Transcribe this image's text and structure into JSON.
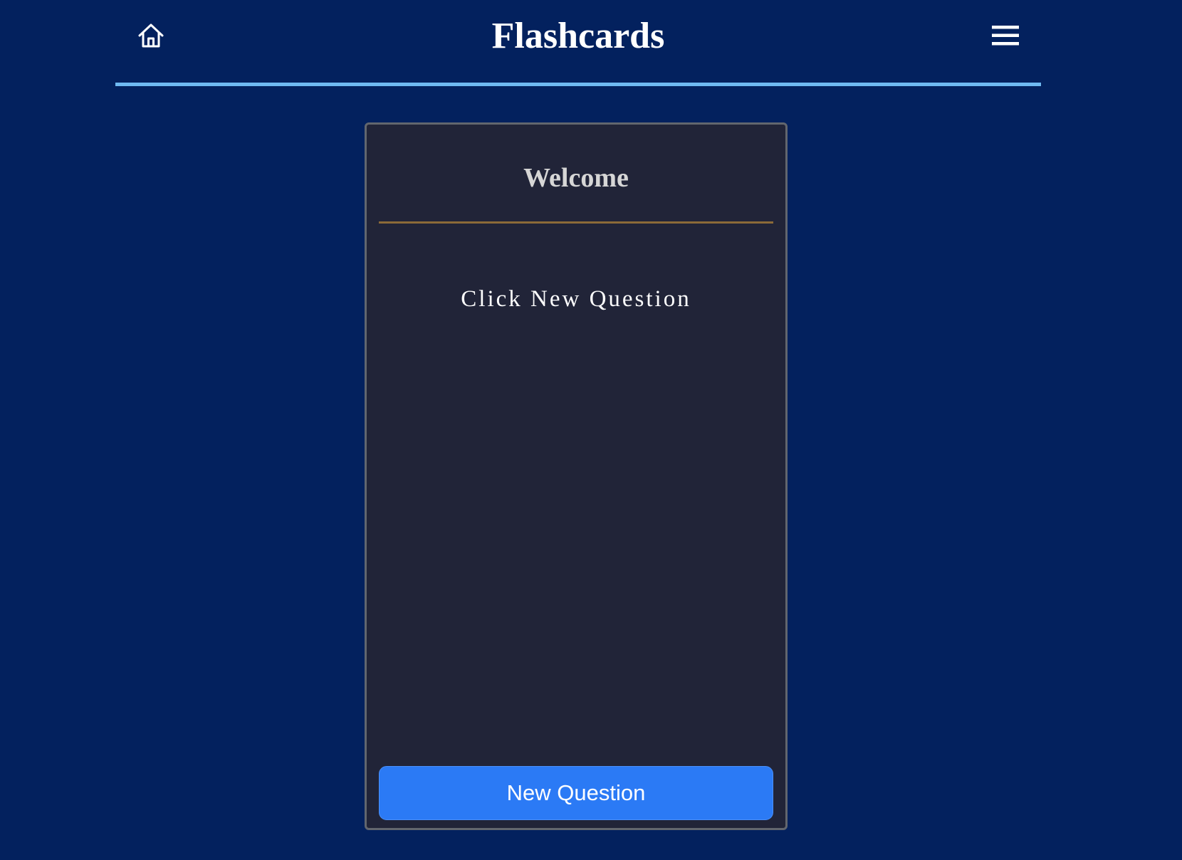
{
  "header": {
    "title": "Flashcards",
    "home_icon": "home-icon",
    "menu_icon": "hamburger-menu-icon",
    "accent_color": "#6fbaf2"
  },
  "card": {
    "title": "Welcome",
    "prompt": "Click New Question",
    "button_label": "New Question",
    "button_color": "#2b7af5",
    "divider_color": "#8b6a38"
  },
  "colors": {
    "page_background": "#03215e",
    "card_background": "#212438"
  }
}
